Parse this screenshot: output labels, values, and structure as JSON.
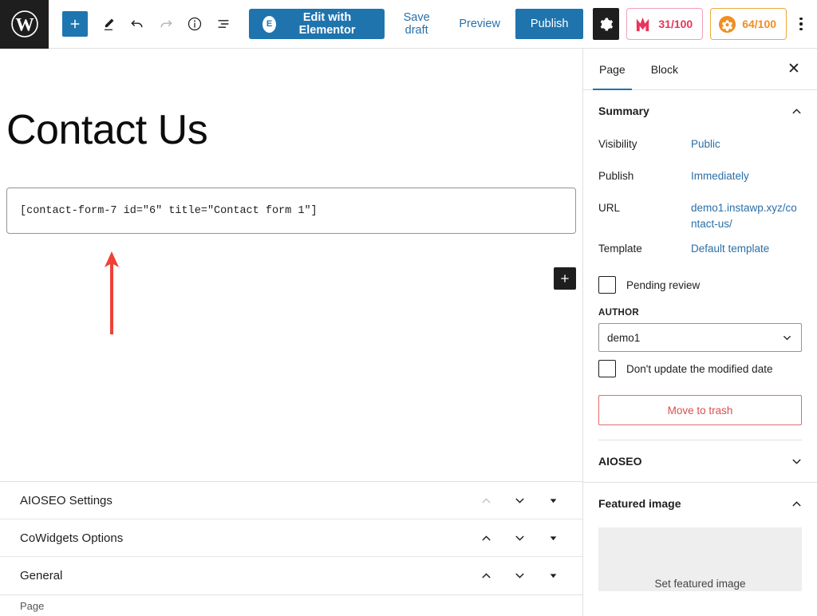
{
  "toolbar": {
    "wp_logo": "wordpress-logo",
    "add_block_label": "+",
    "icons": [
      "add-block-icon",
      "edit-pencil-icon",
      "undo-icon",
      "redo-icon",
      "details-info-icon",
      "list-view-icon"
    ],
    "elementor_button": "Edit with Elementor",
    "elementor_mark": "E",
    "save_draft": "Save draft",
    "preview": "Preview",
    "publish": "Publish",
    "settings_icon": "gear-icon",
    "seo_score": "31/100",
    "performance_score": "64/100",
    "seo_color": "#e8355a",
    "performance_color": "#f28d1e",
    "options_icon": "kebab-menu-icon"
  },
  "editor": {
    "title": "Contact Us",
    "shortcode": "[contact-form-7 id=\"6\" title=\"Contact form 1\"]",
    "inserter_label": "+",
    "annotation": "red-up-arrow",
    "annotation_color": "#ef4136",
    "breadcrumb": "Page",
    "meta_panels": [
      {
        "title": "AIOSEO Settings",
        "up_disabled": true
      },
      {
        "title": "CoWidgets Options",
        "up_disabled": false
      },
      {
        "title": "General",
        "up_disabled": false
      }
    ]
  },
  "sidebar": {
    "tabs": [
      {
        "label": "Page",
        "active": true
      },
      {
        "label": "Block",
        "active": false
      }
    ],
    "close_label": "✕",
    "summary": {
      "title": "Summary",
      "rows": [
        {
          "key": "Visibility",
          "value": "Public"
        },
        {
          "key": "Publish",
          "value": "Immediately"
        },
        {
          "key": "URL",
          "value": "demo1.instawp.xyz/contact-us/"
        },
        {
          "key": "Template",
          "value": "Default template"
        }
      ],
      "pending_review": "Pending review",
      "author_label": "AUTHOR",
      "author_value": "demo1",
      "dont_update_label": "Don't update the modified date",
      "trash_label": "Move to trash"
    },
    "aioseo_title": "AIOSEO",
    "featured": {
      "title": "Featured image",
      "placeholder": "Set featured image"
    },
    "accent": "#1f74ae"
  }
}
